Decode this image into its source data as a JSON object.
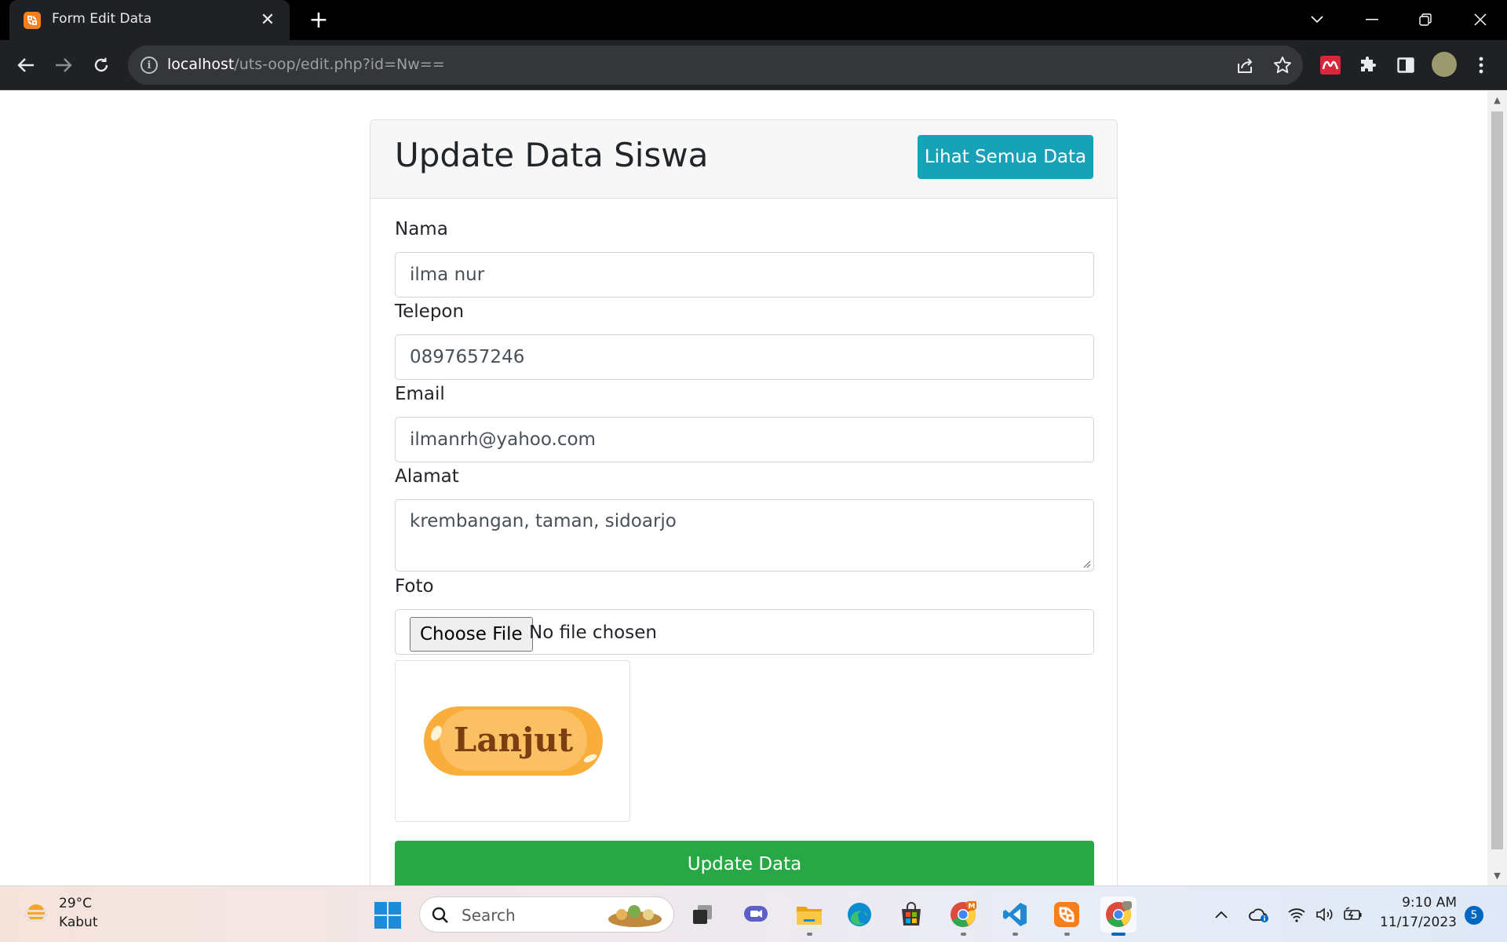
{
  "browser": {
    "tab_title": "Form Edit Data",
    "favicon_glyph": "☒",
    "url_host": "localhost",
    "url_path": "/uts-oop/edit.php?id=Nw=="
  },
  "page": {
    "title": "Update Data Siswa",
    "view_all_button": "Lihat Semua Data",
    "fields": {
      "nama": {
        "label": "Nama",
        "value": "ilma nur"
      },
      "telepon": {
        "label": "Telepon",
        "value": "0897657246"
      },
      "email": {
        "label": "Email",
        "value": "ilmanrh@yahoo.com"
      },
      "alamat": {
        "label": "Alamat",
        "value": "krembangan, taman, sidoarjo"
      },
      "foto": {
        "label": "Foto",
        "button": "Choose File",
        "status": "No file chosen"
      }
    },
    "image_text": "Lanjut",
    "submit_button": "Update Data",
    "colors": {
      "info": "#17a2b8",
      "success": "#28a745",
      "image_pill": "#f9ae3b",
      "image_text": "#7a3e10"
    }
  },
  "taskbar": {
    "weather_temp": "29°C",
    "weather_desc": "Kabut",
    "search_placeholder": "Search",
    "time": "9:10 AM",
    "date": "11/17/2023",
    "notification_count": "5",
    "chrome_badge": "M",
    "apps": [
      "task-view-icon",
      "meet-icon",
      "file-explorer-icon",
      "edge-icon",
      "store-icon",
      "chrome-icon",
      "vscode-icon",
      "xampp-icon",
      "chrome-active-icon"
    ]
  }
}
